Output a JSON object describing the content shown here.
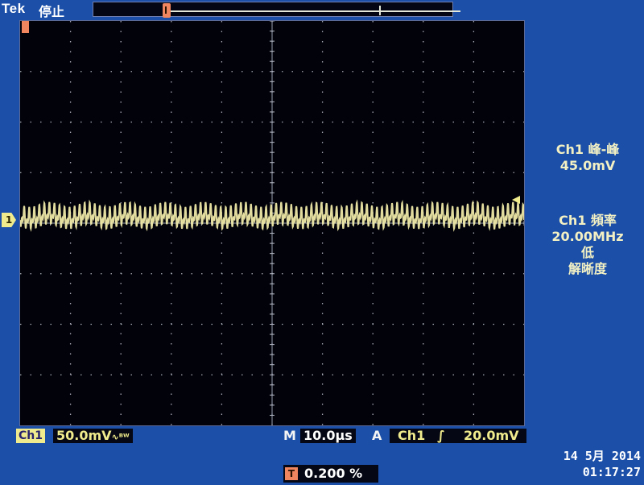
{
  "header": {
    "brand": "Tek",
    "status": "停止"
  },
  "screen": {
    "ch1_marker": "1",
    "trigger_pos_marker": "T"
  },
  "measurements": {
    "m1_label": "Ch1 峰-峰",
    "m1_value": "45.0mV",
    "m2_label": "Ch1 頻率",
    "m2_value": "20.00MHz",
    "m2_note1": "低",
    "m2_note2": "解晰度"
  },
  "bottom": {
    "ch_label": "Ch1",
    "ch_scale": "50.0mV",
    "ch_bw_icon": "∿ᴮᵂ",
    "m_label": "M",
    "m_value": "10.0µs",
    "a_label": "A",
    "trig_source": "Ch1",
    "trig_slope": "∫",
    "trig_level": "20.0mV",
    "tpos_icon": "T",
    "tpos_value": "0.200 %",
    "date": "14 5月  2014",
    "time": "01:17:27"
  },
  "colors": {
    "background": "#1b4fa8",
    "screen": "#02030a",
    "ch1": "#f0eb8c",
    "marker": "#f08660"
  }
}
